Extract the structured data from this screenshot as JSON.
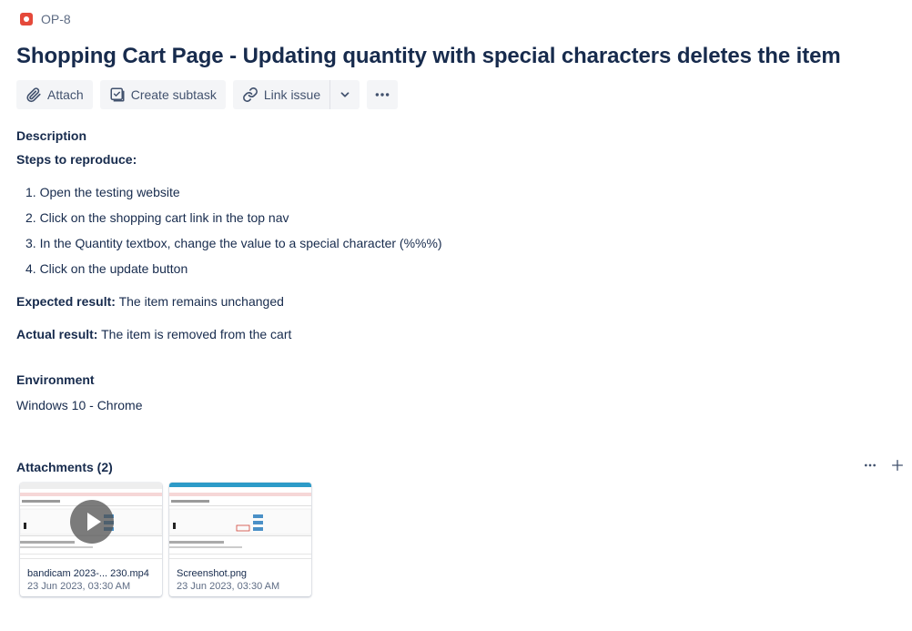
{
  "issue": {
    "key": "OP-8",
    "title": "Shopping Cart Page - Updating quantity with special characters deletes the item"
  },
  "toolbar": {
    "attach_label": "Attach",
    "create_subtask_label": "Create subtask",
    "link_issue_label": "Link issue"
  },
  "description": {
    "label": "Description",
    "steps_heading": "Steps to reproduce:",
    "steps": [
      "1. Open the testing website",
      "2. Click on the shopping cart link in the top nav",
      "3. In the Quantity textbox, change the value to a special character (%%%)",
      "4. Click on the update button"
    ],
    "expected_label": "Expected result:",
    "expected_value": "The item remains unchanged",
    "actual_label": "Actual result:",
    "actual_value": "The item is removed from the cart"
  },
  "environment": {
    "label": "Environment",
    "value": "Windows 10 - Chrome"
  },
  "attachments": {
    "label": "Attachments (2)",
    "items": [
      {
        "name": "bandicam 2023-... 230.mp4",
        "date": "23 Jun 2023, 03:30 AM",
        "type": "video"
      },
      {
        "name": "Screenshot.png",
        "date": "23 Jun 2023, 03:30 AM",
        "type": "image"
      }
    ]
  },
  "colors": {
    "bug_icon": "#e5493a",
    "text_primary": "#172b4d",
    "button_bg": "#f4f5f7",
    "thumb_header": "#2d9bc8"
  },
  "icons": {
    "issue_type": "bug-icon",
    "attach": "paperclip-icon",
    "subtask": "subtask-icon",
    "link": "link-icon",
    "dropdown": "chevron-down-icon",
    "more": "more-icon",
    "add": "plus-icon",
    "play": "play-icon"
  }
}
